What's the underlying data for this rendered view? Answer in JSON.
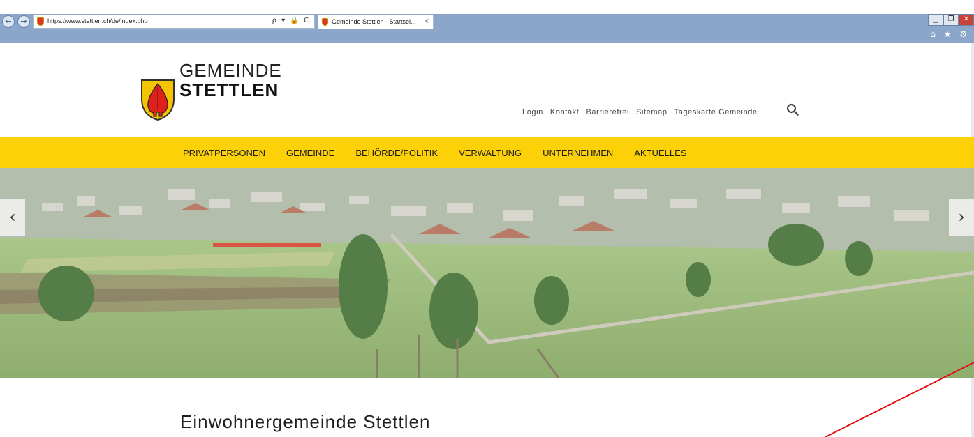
{
  "browser": {
    "url": "https://www.stettlen.ch/de/index.php",
    "tab_title": "Gemeinde Stettlen - Startsei...",
    "tab_close": "×",
    "back_glyph": "←",
    "forward_glyph": "→",
    "address_tools": "ρ ▾ 🔒 C",
    "window_controls": {
      "minimize": "▁",
      "restore": "❐",
      "close": "✕"
    },
    "toolbar_icons": "⌂ ★ ⚙"
  },
  "header": {
    "logo_line1": "GEMEINDE",
    "logo_line2": "STETTLEN",
    "top_links": [
      "Login",
      "Kontakt",
      "Barrierefrei",
      "Sitemap",
      "Tageskarte Gemeinde"
    ]
  },
  "main_nav": {
    "items": [
      "PRIVATPERSONEN",
      "GEMEINDE",
      "BEHÖRDE/POLITIK",
      "VERWALTUNG",
      "UNTERNEHMEN",
      "AKTUELLES"
    ]
  },
  "slider": {
    "prev_glyph": "‹",
    "next_glyph": "›"
  },
  "content": {
    "heading": "Einwohnergemeinde Stettlen"
  },
  "colors": {
    "accent_yellow": "#fcd107",
    "chrome_blue": "#8ba6c9",
    "annotation_red": "#e01010"
  },
  "icons": [
    "search-icon",
    "shield-logo-icon",
    "back-icon",
    "forward-icon",
    "home-icon",
    "star-icon",
    "gear-icon"
  ]
}
